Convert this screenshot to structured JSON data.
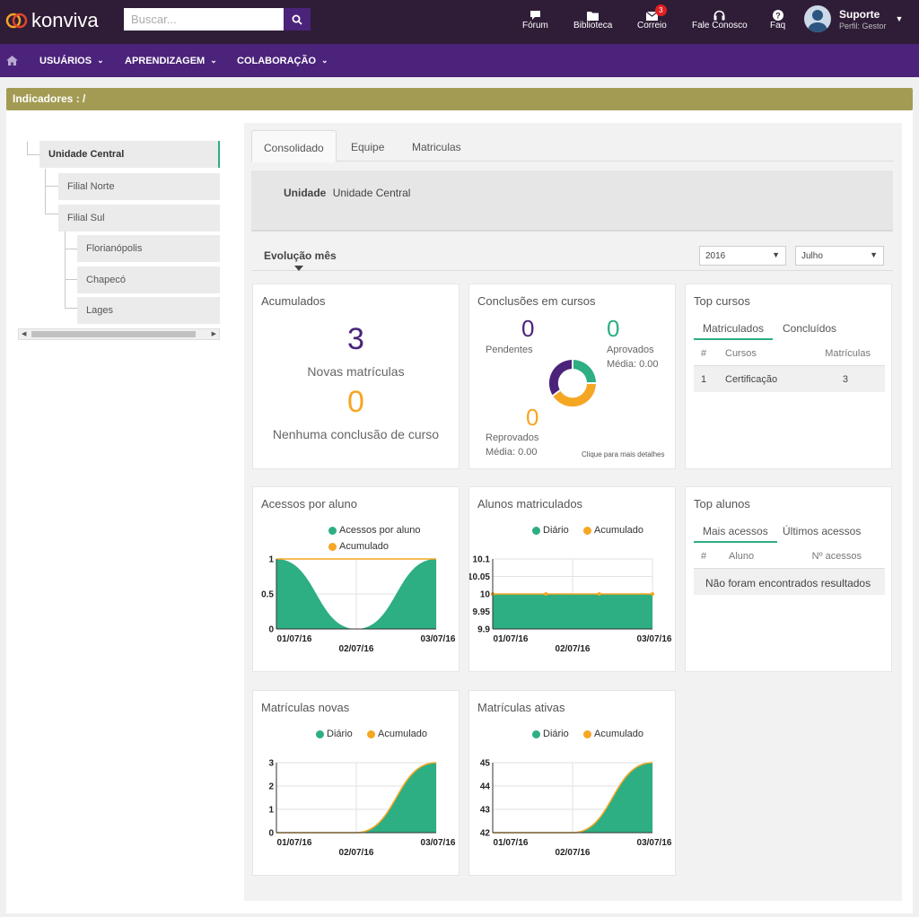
{
  "app": {
    "logo_text": "konviva"
  },
  "search": {
    "placeholder": "Buscar..."
  },
  "topnav": {
    "forum": "Fórum",
    "biblioteca": "Biblioteca",
    "correio": "Correio",
    "correio_badge": "3",
    "fale_conosco": "Fale Conosco",
    "faq": "Faq"
  },
  "user": {
    "name": "Suporte",
    "role": "Perfil: Gestor"
  },
  "mainnav": {
    "usuarios": "USUÁRIOS",
    "aprendizagem": "APRENDIZAGEM",
    "colaboracao": "COLABORAÇÃO"
  },
  "breadcrumb": "Indicadores : /",
  "tree": {
    "items": [
      "Unidade Central",
      "Filial Norte",
      "Filial Sul",
      "Florianópolis",
      "Chapecó",
      "Lages"
    ]
  },
  "tabs": [
    "Consolidado",
    "Equipe",
    "Matriculas"
  ],
  "unit": {
    "label": "Unidade",
    "value": "Unidade Central"
  },
  "evolucao": {
    "label": "Evolução mês",
    "year": "2016",
    "month": "Julho"
  },
  "acumulados": {
    "title": "Acumulados",
    "novas_value": "3",
    "novas_label": "Novas matrículas",
    "conclusoes_value": "0",
    "conclusoes_label": "Nenhuma conclusão de curso"
  },
  "conclusoes": {
    "title": "Conclusões em cursos",
    "pendentes_value": "0",
    "pendentes_label": "Pendentes",
    "aprovados_value": "0",
    "aprovados_label": "Aprovados",
    "aprovados_media": "Média: 0.00",
    "reprovados_value": "0",
    "reprovados_label": "Reprovados",
    "reprovados_media": "Média: 0.00",
    "detalhes_link": "Clique para mais detalhes"
  },
  "top_cursos": {
    "title": "Top cursos",
    "tabs": [
      "Matriculados",
      "Concluídos"
    ],
    "headers": [
      "#",
      "Cursos",
      "Matrículas"
    ],
    "rows": [
      {
        "rank": "1",
        "curso": "Certificação",
        "matriculas": "3"
      }
    ]
  },
  "top_alunos": {
    "title": "Top alunos",
    "tabs": [
      "Mais acessos",
      "Últimos acessos"
    ],
    "headers": [
      "#",
      "Aluno",
      "Nº acessos"
    ],
    "empty": "Não foram encontrados resultados"
  },
  "colors": {
    "green": "#2dae83",
    "orange": "#f5a623",
    "purple": "#4b237a",
    "dark": "#2f1d37"
  },
  "chart_data": [
    {
      "id": "acessos",
      "type": "area",
      "title": "Acessos por aluno",
      "legend": [
        "Acessos por aluno",
        "Acumulado"
      ],
      "x": [
        "01/07/16",
        "02/07/16",
        "03/07/16"
      ],
      "x_ticks": [
        "01/07/16",
        "02/07/16",
        "03/07/16"
      ],
      "y_ticks": [
        "1",
        "0.5",
        "0"
      ],
      "ylim": [
        0,
        1
      ],
      "series": [
        {
          "name": "Acessos por aluno",
          "values": [
            1,
            0,
            1
          ]
        },
        {
          "name": "Acumulado",
          "values": [
            1,
            1,
            1
          ]
        }
      ]
    },
    {
      "id": "alunos",
      "type": "area",
      "title": "Alunos matriculados",
      "legend": [
        "Diário",
        "Acumulado"
      ],
      "x": [
        "01/07/16",
        "02/07/16",
        "03/07/16"
      ],
      "x_ticks": [
        "01/07/16",
        "02/07/16",
        "03/07/16"
      ],
      "y_ticks": [
        "10.1",
        "10.05",
        "10",
        "9.95",
        "9.9"
      ],
      "ylim": [
        9.9,
        10.1
      ],
      "series": [
        {
          "name": "Diário",
          "values": [
            10,
            10,
            10
          ]
        },
        {
          "name": "Acumulado",
          "values": [
            10,
            10,
            10
          ]
        }
      ]
    },
    {
      "id": "novas",
      "type": "area",
      "title": "Matrículas novas",
      "legend": [
        "Diário",
        "Acumulado"
      ],
      "x": [
        "01/07/16",
        "02/07/16",
        "03/07/16"
      ],
      "x_ticks": [
        "01/07/16",
        "02/07/16",
        "03/07/16"
      ],
      "y_ticks": [
        "3",
        "2",
        "1",
        "0"
      ],
      "ylim": [
        0,
        3
      ],
      "series": [
        {
          "name": "Diário",
          "values": [
            0,
            0,
            3
          ]
        },
        {
          "name": "Acumulado",
          "values": [
            0,
            0,
            3
          ]
        }
      ]
    },
    {
      "id": "ativas",
      "type": "area",
      "title": "Matrículas ativas",
      "legend": [
        "Diário",
        "Acumulado"
      ],
      "x": [
        "01/07/16",
        "02/07/16",
        "03/07/16"
      ],
      "x_ticks": [
        "01/07/16",
        "02/07/16",
        "03/07/16"
      ],
      "y_ticks": [
        "45",
        "44",
        "43",
        "42"
      ],
      "ylim": [
        42,
        45
      ],
      "series": [
        {
          "name": "Diário",
          "values": [
            42,
            42,
            45
          ]
        },
        {
          "name": "Acumulado",
          "values": [
            42,
            42,
            45
          ]
        }
      ]
    }
  ]
}
